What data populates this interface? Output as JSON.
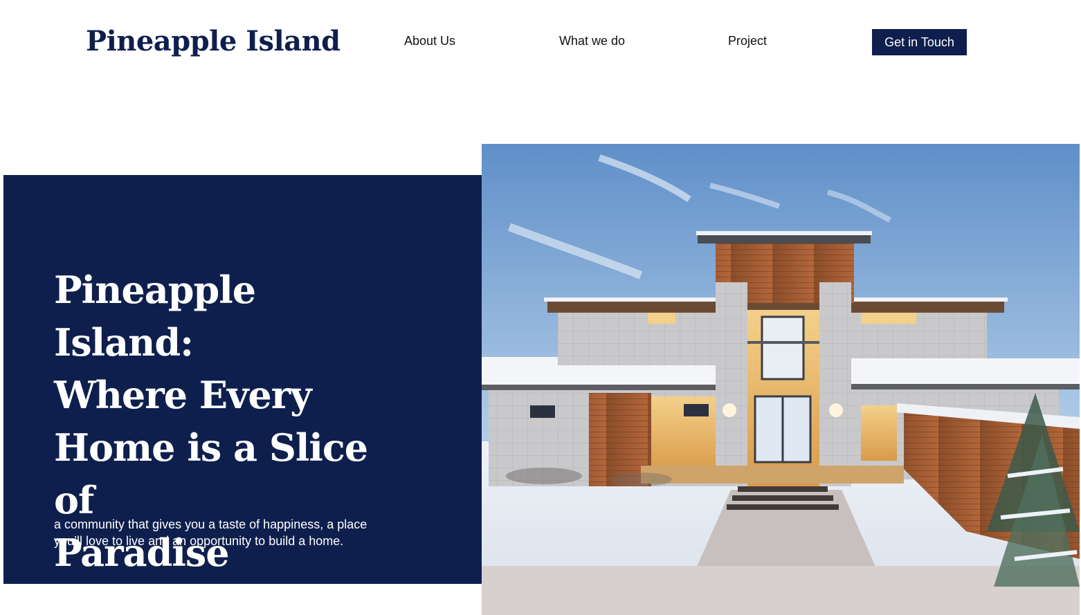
{
  "header": {
    "logo": "Pineapple Island",
    "nav": {
      "about": "About Us",
      "what_we_do": "What we do",
      "project": "Project"
    },
    "cta_label": "Get in Touch"
  },
  "hero": {
    "title_lines": [
      "Pineapple Island:",
      "Where Every",
      "Home is a Slice of",
      "Paradise"
    ],
    "subtitle_lines": [
      "a community that gives you a taste of happiness, a place",
      "you’ll love to live and an opportunity to build a home."
    ]
  },
  "colors": {
    "brand_navy": "#0f1f4d",
    "background": "#ffffff",
    "text_dark": "#111111"
  }
}
